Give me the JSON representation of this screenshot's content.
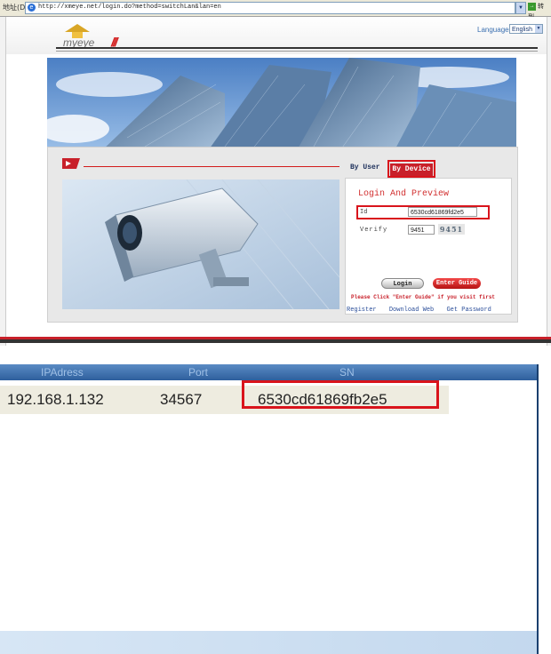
{
  "browser": {
    "address_label": "地址(D)",
    "url": "http://xmeye.net/login.do?method=switchLan&lan=en",
    "go_label": "转到"
  },
  "site": {
    "logo_text": "myeye",
    "language_label": "Language:",
    "language_value": "English",
    "login": {
      "tab_user": "By User",
      "tab_device": "By Device",
      "title": "Login And Preview",
      "id_label": "Id",
      "id_value": "6530cd61869fd2e5",
      "verify_label": "Verify",
      "verify_value": "9451",
      "captcha": "9451",
      "login_button": "Login",
      "guide_button": "Enter Guide",
      "notice": "Please Click \"Enter Guide\" if you visit first",
      "links": [
        "Register",
        "Download Web",
        "Get Password"
      ]
    }
  },
  "device_list": {
    "columns": [
      "IPAdress",
      "Port",
      "SN"
    ],
    "rows": [
      {
        "ip": "192.168.1.132",
        "port": "34567",
        "sn": "6530cd61869fb2e5"
      }
    ]
  },
  "colors": {
    "accent_red": "#d9141c",
    "header_blue": "#2e5f9d",
    "link_blue": "#2c4f9a"
  }
}
